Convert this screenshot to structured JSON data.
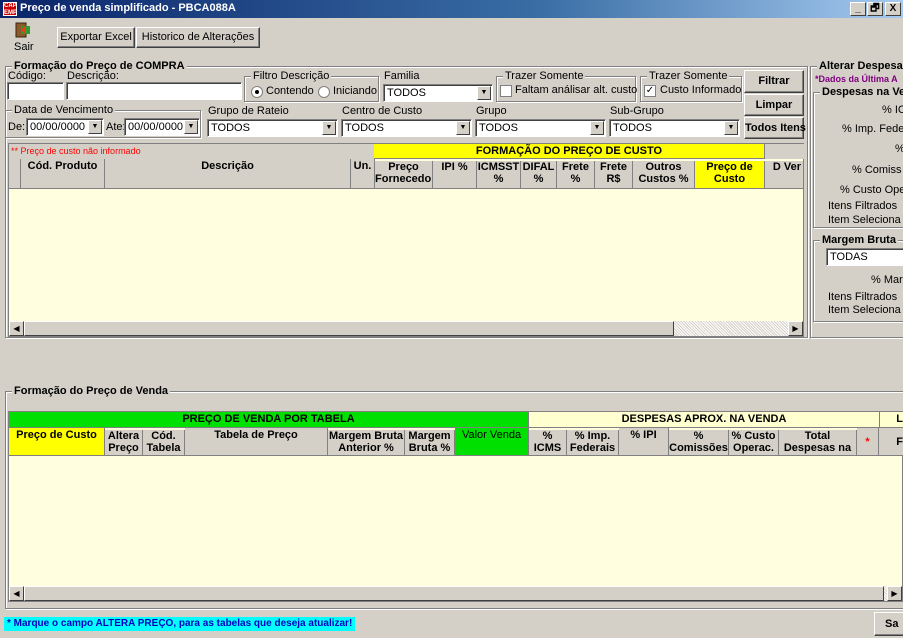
{
  "window": {
    "title": "Preço de venda simplificado - PBCA088A",
    "icon_text": "CAP EMP",
    "controls": [
      "_",
      "🗗",
      "X"
    ]
  },
  "toolbar": {
    "exit_label": "Sair",
    "export_excel_label": "Exportar Excel",
    "history_label": "Historico de Alterações"
  },
  "compra": {
    "group_label": "Formação do Preço de COMPRA",
    "codigo_label": "Código:",
    "codigo_value": "",
    "descricao_label": "Descrição:",
    "descricao_value": "",
    "filtro_label": "Filtro Descrição",
    "filtro_contendo": "Contendo",
    "filtro_iniciando": "Iniciando",
    "familia_label": "Familia",
    "familia_value": "TODOS",
    "trazer1_label": "Trazer Somente",
    "trazer1_check": "Faltam análisar alt. custo",
    "trazer2_label": "Trazer Somente",
    "trazer2_check": "Custo Informado",
    "trazer2_checkmark": "✓",
    "filtrar_label": "Filtrar",
    "limpar_label": "Limpar",
    "todos_itens_label": "Todos Itens",
    "vencimento_label": "Data de Vencimento",
    "de_label": "De:",
    "de_value": "00/00/0000",
    "ate_label": "Ate:",
    "ate_value": "00/00/0000",
    "rateio_label": "Grupo de Rateio",
    "rateio_value": "TODOS",
    "centro_label": "Centro de Custo",
    "centro_value": "TODOS",
    "grupo_label": "Grupo",
    "grupo_value": "TODOS",
    "subgrupo_label": "Sub-Grupo",
    "subgrupo_value": "TODOS",
    "nota": "** Preço de custo não informado"
  },
  "custo_grid": {
    "band_title": "FORMAÇÃO DO PREÇO DE CUSTO",
    "columns": [
      "Cód. Produto",
      "Descrição",
      "Un.",
      "Preço Fornecedor",
      "IPI %",
      "ICMSST %",
      "DIFAL %",
      "Frete %",
      "Frete R$",
      "Outros Custos %",
      "Preço de Custo",
      "D Ver"
    ]
  },
  "despesas": {
    "group_label": "Alterar Despesas",
    "subtitle": "*Dados da Última A",
    "inner_label": "Despesas na Ve",
    "rows": [
      "% IC",
      "% Imp. Fede",
      "%",
      "% Comiss",
      "% Custo Ope",
      "Itens Filtrados",
      "Item Seleciona"
    ],
    "margem_label": "Margem Bruta",
    "margem_value": "TODAS",
    "margem_rows": [
      "% Mar",
      "Itens Filtrados",
      "Item Seleciona"
    ]
  },
  "venda": {
    "group_label": "Formação do Preço de Venda",
    "band_tabela": "PREÇO DE VENDA POR TABELA",
    "band_despesas": "DESPESAS APROX. NA VENDA",
    "band_extra": "L",
    "columns": [
      "Preço de Custo",
      "Altera Preço",
      "Cód. Tabela",
      "Tabela de Preço",
      "Margem Bruta Anterior %",
      "Margem Bruta %",
      "Valor Venda",
      "% ICMS",
      "% Imp. Federais",
      "% IPI",
      "% Comissões",
      "% Custo Operac.",
      "Total Despesas na Venda R$",
      "*",
      "F"
    ]
  },
  "footer": {
    "note": "* Marque o campo ALTERA PREÇO, para as tabelas que deseja atualizar!",
    "save_label": "Sa"
  },
  "colors": {
    "title_bar": "#0a246a",
    "yellow": "#ffff00",
    "green": "#00e000",
    "grid_bg": "#ffffe0",
    "note_bg": "#00ffff",
    "red_note": "#ff0000",
    "purple": "#800080"
  }
}
